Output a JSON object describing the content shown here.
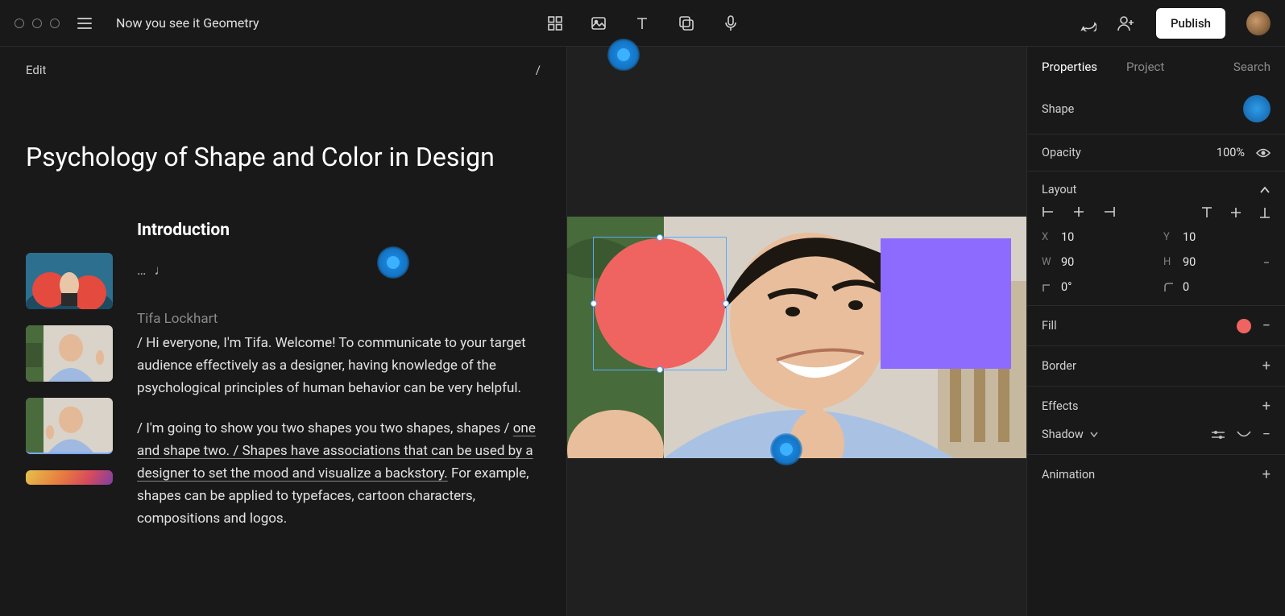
{
  "topbar": {
    "title_value": "Now you see it Geometry",
    "publish_label": "Publish"
  },
  "editor": {
    "edit_label": "Edit",
    "slash": "/",
    "page_title": "Psychology of Shape and Color in Design",
    "section_heading": "Introduction",
    "ellipsis": "…",
    "music_glyph": "♩",
    "speaker_name": "Tifa Lockhart",
    "para1": "/ Hi everyone, I'm Tifa. Welcome! To communicate to your target audience effectively as a designer, having knowledge of the psychological principles of human behavior can be very helpful.",
    "para2_a": "/ I'm going to show you two shapes you two shapes, shapes / ",
    "para2_u": "one and shape two. / Shapes have associations that can be used by a designer to set the mood and visualize a backstory.",
    "para2_c": " For example, shapes can be applied to typefaces, cartoon characters, compositions and logos."
  },
  "rpanel": {
    "tabs": {
      "properties": "Properties",
      "project": "Project",
      "search": "Search"
    },
    "shape_label": "Shape",
    "opacity_label": "Opacity",
    "opacity_value": "100%",
    "layout_label": "Layout",
    "X_label": "X",
    "X_val": "10",
    "Y_label": "Y",
    "Y_val": "10",
    "W_label": "W",
    "W_val": "90",
    "H_label": "H",
    "H_val": "90",
    "rot_val": "0°",
    "corner_val": "0",
    "fill_label": "Fill",
    "border_label": "Border",
    "effects_label": "Effects",
    "shadow_label": "Shadow",
    "animation_label": "Animation"
  },
  "colors": {
    "circle_fill": "#EF6461",
    "rect_fill": "#8E6BFF"
  }
}
